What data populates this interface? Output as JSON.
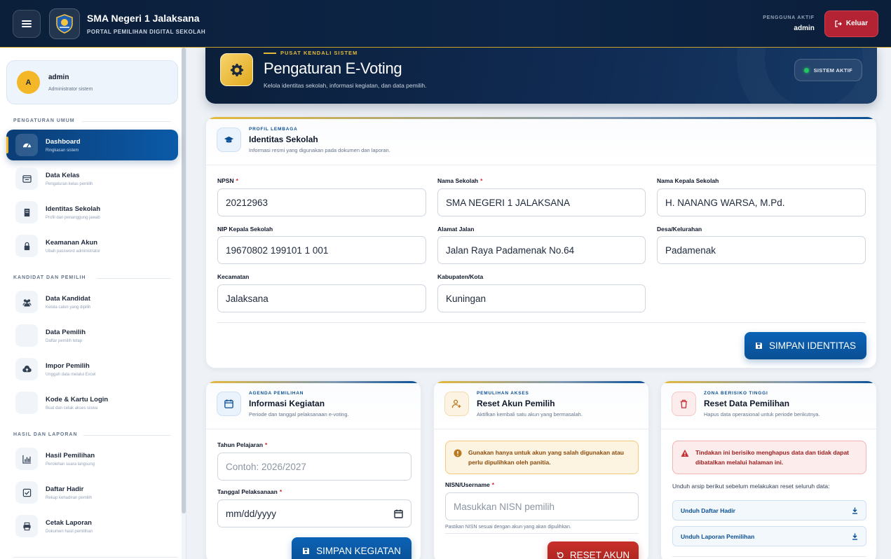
{
  "topbar": {
    "brand_title": "SMA Negeri 1 Jalaksana",
    "brand_subtitle": "PORTAL PEMILIHAN DIGITAL SEKOLAH",
    "user_caption": "PENGGUNA AKTIF",
    "user_name": "admin",
    "logout_label": "Keluar"
  },
  "sidebar": {
    "profile": {
      "initial": "A",
      "name": "admin",
      "role": "Administrator sistem"
    },
    "sections": [
      {
        "title": "PENGATURAN UMUM"
      },
      {
        "title": "KANDIDAT DAN PEMILIH"
      },
      {
        "title": "HASIL DAN LAPORAN"
      }
    ],
    "items": [
      {
        "label": "Dashboard",
        "desc": "Ringkasan sistem",
        "icon": "dashboard-icon"
      },
      {
        "label": "Data Kelas",
        "desc": "Pengaturan kelas pemilih",
        "icon": "list-icon"
      },
      {
        "label": "Identitas Sekolah",
        "desc": "Profil dan penanggung jawab",
        "icon": "building-icon"
      },
      {
        "label": "Keamanan Akun",
        "desc": "Ubah password administrator",
        "icon": "lock-icon"
      },
      {
        "label": "Data Kandidat",
        "desc": "Kelola calon yang dipilih",
        "icon": "users-icon"
      },
      {
        "label": "Data Pemilih",
        "desc": "Daftar pemilih tetap",
        "icon": "user-icon"
      },
      {
        "label": "Impor Pemilih",
        "desc": "Unggah data melalui Excel",
        "icon": "upload-icon"
      },
      {
        "label": "Kode & Kartu Login",
        "desc": "Buat dan cetak akses siswa",
        "icon": "card-icon"
      },
      {
        "label": "Hasil Pemilihan",
        "desc": "Perolehan suara langsung",
        "icon": "chart-icon"
      },
      {
        "label": "Daftar Hadir",
        "desc": "Rekap kehadiran pemilih",
        "icon": "check-icon"
      },
      {
        "label": "Cetak Laporan",
        "desc": "Dokumen hasil pemilihan",
        "icon": "print-icon"
      }
    ]
  },
  "banner": {
    "kicker": "PUSAT KENDALI SISTEM",
    "title": "Pengaturan E-Voting",
    "subtitle": "Kelola identitas sekolah, informasi kegiatan, dan data pemilih.",
    "status": "SISTEM AKTIF"
  },
  "identity": {
    "kicker": "PROFIL LEMBAGA",
    "title": "Identitas Sekolah",
    "subtitle": "Informasi resmi yang digunakan pada dokumen dan laporan.",
    "fields": {
      "npsn": {
        "label": "NPSN",
        "value": "20212963"
      },
      "nama_sekolah": {
        "label": "Nama Sekolah",
        "value": "SMA NEGERI 1 JALAKSANA"
      },
      "kepala": {
        "label": "Nama Kepala Sekolah",
        "value": "H. NANANG WARSA, M.Pd."
      },
      "nip": {
        "label": "NIP Kepala Sekolah",
        "value": "19670802 199101 1 001"
      },
      "alamat": {
        "label": "Alamat Jalan",
        "value": "Jalan Raya Padamenak No.64"
      },
      "desa": {
        "label": "Desa/Kelurahan",
        "value": "Padamenak"
      },
      "kecamatan": {
        "label": "Kecamatan",
        "value": "Jalaksana"
      },
      "kabupaten": {
        "label": "Kabupaten/Kota",
        "value": "Kuningan"
      }
    },
    "required_mark": "*",
    "save_label": "SIMPAN IDENTITAS"
  },
  "event": {
    "kicker": "AGENDA PEMILIHAN",
    "title": "Informasi Kegiatan",
    "subtitle": "Periode dan tanggal pelaksanaan e-voting.",
    "year_label": "Tahun Pelajaran",
    "year_placeholder": "Contoh: 2026/2027",
    "date_label": "Tanggal Pelaksanaan",
    "date_placeholder": "mm/dd/yyyy",
    "save_label": "SIMPAN KEGIATAN"
  },
  "reset_account": {
    "kicker": "PEMULIHAN AKSES",
    "title": "Reset Akun Pemilih",
    "subtitle": "Aktifkan kembali satu akun yang bermasalah.",
    "warning": "Gunakan hanya untuk akun yang salah digunakan atau perlu dipulihkan oleh panitia.",
    "field_label": "NISN/Username",
    "field_placeholder": "Masukkan NISN pemilih",
    "hint": "Pastikan NISN sesuai dengan akun yang akan dipulihkan.",
    "button_label": "RESET AKUN"
  },
  "reset_data": {
    "kicker": "ZONA BERISIKO TINGGI",
    "title": "Reset Data Pemilihan",
    "subtitle": "Hapus data operasional untuk periode berikutnya.",
    "danger": "Tindakan ini berisiko menghapus data dan tidak dapat dibatalkan melalui halaman ini.",
    "note": "Unduh arsip berikut sebelum melakukan reset seluruh data:",
    "download_attendance": "Unduh Daftar Hadir",
    "download_report": "Unduh Laporan Pemilihan"
  },
  "colors": {
    "navy": "#0b1f3a",
    "primary": "#0a4f94",
    "gold": "#e5b93a",
    "danger": "#b42333",
    "success": "#22c55e"
  }
}
